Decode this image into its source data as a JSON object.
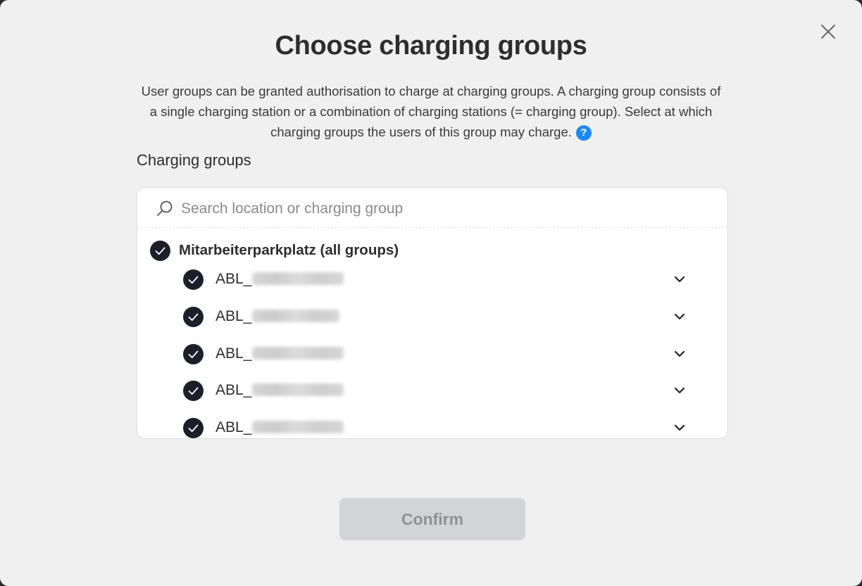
{
  "dialog": {
    "title": "Choose charging groups",
    "description": "User groups can be granted authorisation to charge at charging groups. A charging group consists of a single charging station or a combination of charging stations (= charging group). Select at which charging groups the users of this group may charge.",
    "help_icon": "?",
    "section_label": "Charging groups",
    "confirm_label": "Confirm",
    "close_icon": "close-icon"
  },
  "search": {
    "placeholder": "Search location or charging group",
    "value": "",
    "icon": "search-icon"
  },
  "location": {
    "label": "Mitarbeiterparkplatz (all groups)",
    "checked": true,
    "groups": [
      {
        "prefix": "ABL_",
        "checked": true,
        "id_blurred": true
      },
      {
        "prefix": "ABL_",
        "checked": true,
        "id_blurred": true
      },
      {
        "prefix": "ABL_",
        "checked": true,
        "id_blurred": true
      },
      {
        "prefix": "ABL_",
        "checked": true,
        "id_blurred": true
      },
      {
        "prefix": "ABL_",
        "checked": true,
        "id_blurred": true
      }
    ]
  },
  "colors": {
    "check_fill": "#1c1f2a",
    "help_blue": "#1e88f0",
    "confirm_disabled_bg": "#d3d4d7",
    "confirm_disabled_text": "#8f9196"
  }
}
